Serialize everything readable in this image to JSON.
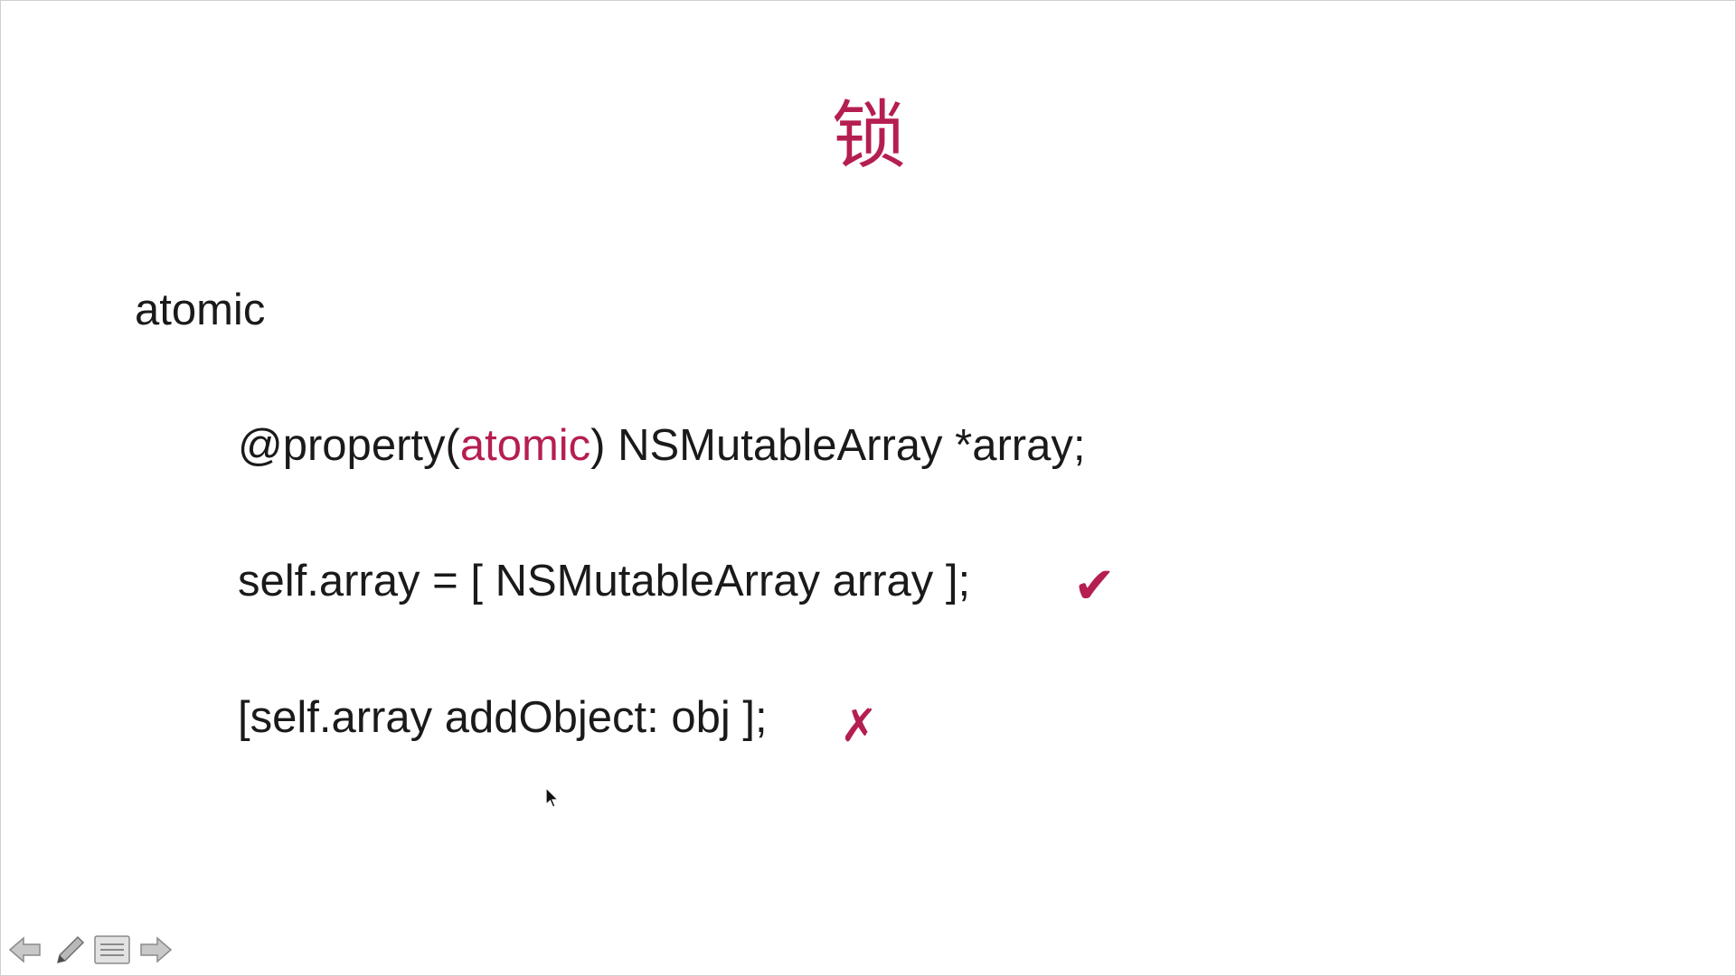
{
  "slide": {
    "title": "锁",
    "heading": "atomic",
    "line1": {
      "prefix": "@property(",
      "keyword": "atomic",
      "suffix": ") NSMutableArray *array;"
    },
    "line2": {
      "text": "self.array = [ NSMutableArray array ];",
      "mark": "✔"
    },
    "line3": {
      "text": "[self.array addObject: obj ];",
      "mark": "✗"
    }
  },
  "toolbar": {
    "icons": [
      "previous-arrow-icon",
      "pen-icon",
      "menu-icon",
      "next-arrow-icon"
    ]
  },
  "colors": {
    "accent": "#b51e52",
    "text": "#1a1a1a",
    "background": "#ffffff"
  }
}
